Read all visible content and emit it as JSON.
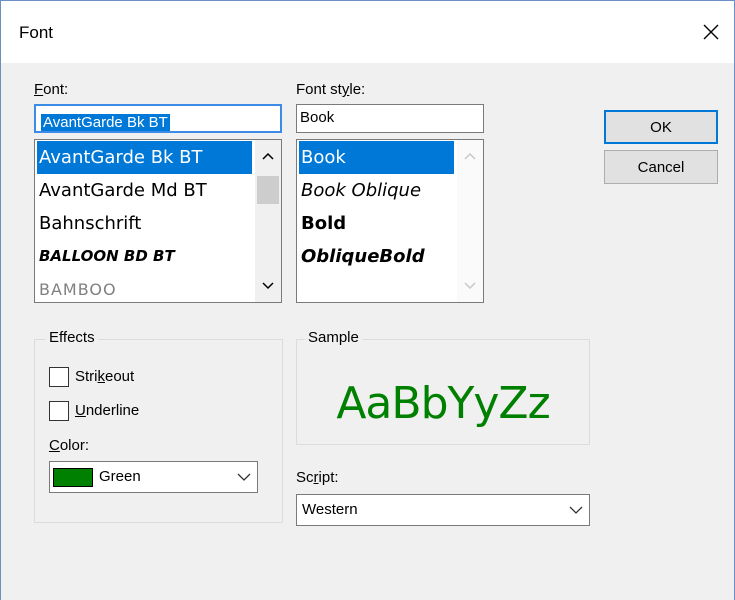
{
  "window": {
    "title": "Font"
  },
  "font": {
    "label_prefix": "F",
    "label_rest": "ont:",
    "value": "AvantGarde Bk BT",
    "items": [
      {
        "label": "AvantGarde Bk BT",
        "selected": true
      },
      {
        "label": "AvantGarde Md BT",
        "selected": false
      },
      {
        "label": "Bahnschrift",
        "selected": false
      },
      {
        "label": "BALLOON BD BT",
        "selected": false
      },
      {
        "label": "BAMBOO",
        "selected": false
      }
    ]
  },
  "font_style": {
    "label_pre": "Font st",
    "label_accel": "y",
    "label_post": "le:",
    "value": "Book",
    "items": [
      {
        "label": "Book",
        "selected": true
      },
      {
        "label": "Book Oblique",
        "selected": false
      },
      {
        "label": "Bold",
        "selected": false
      },
      {
        "label": "ObliqueBold",
        "selected": false
      }
    ]
  },
  "buttons": {
    "ok": "OK",
    "cancel": "Cancel"
  },
  "effects": {
    "title": "Effects",
    "strikeout_pre": "Stri",
    "strikeout_accel": "k",
    "strikeout_post": "eout",
    "strikeout_checked": false,
    "underline_accel": "U",
    "underline_post": "nderline",
    "underline_checked": false,
    "color_accel": "C",
    "color_post": "olor:",
    "color_value": "Green",
    "color_hex": "#008000"
  },
  "sample": {
    "title": "Sample",
    "text": "AaBbYyZz",
    "color": "#008000"
  },
  "script": {
    "label_pre": "Sc",
    "label_accel": "r",
    "label_post": "ipt:",
    "value": "Western"
  },
  "icons": {
    "close": "close-icon",
    "scroll_up": "chevron-up-icon",
    "scroll_down": "chevron-down-icon",
    "dropdown": "chevron-down-icon"
  },
  "colors": {
    "accent": "#0078d7",
    "dialog_bg": "#f0f0f0"
  }
}
